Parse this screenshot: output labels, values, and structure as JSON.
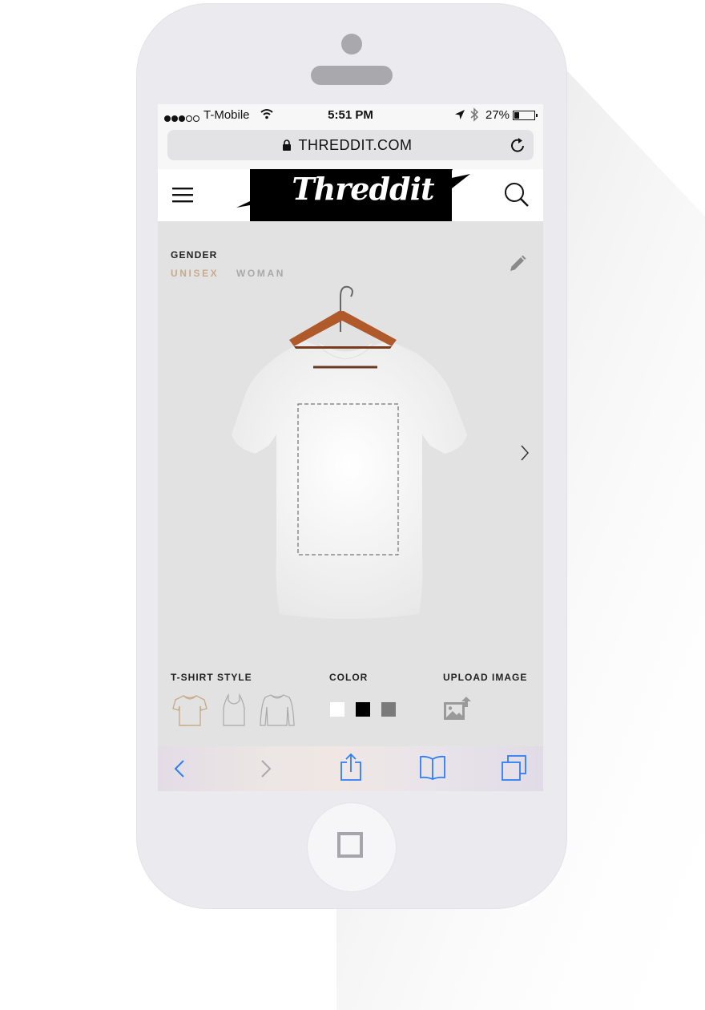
{
  "status_bar": {
    "carrier": "T-Mobile",
    "time": "5:51 PM",
    "battery": "27%",
    "battery_level": 0.27,
    "signal_bars": 3,
    "signal_total": 5
  },
  "url_bar": {
    "url": "THREDDIT.COM"
  },
  "header": {
    "logo_text": "Threddit"
  },
  "gender": {
    "label": "GENDER",
    "options": [
      "UNISEX",
      "WOMAN"
    ],
    "selected": "UNISEX"
  },
  "options": {
    "style_label": "T-SHIRT STYLE",
    "styles": [
      "crew-neck-tee-icon",
      "tank-top-icon",
      "long-sleeve-icon"
    ],
    "selected_style": "crew-neck-tee-icon",
    "color_label": "COLOR",
    "colors": [
      "#ffffff",
      "#000000",
      "#7a7a7a"
    ],
    "upload_label": "UPLOAD IMAGE"
  },
  "colors": {
    "accent": "#c8ab8a",
    "safari_blue": "#2f7ef5",
    "background": "#e2e2e2"
  }
}
